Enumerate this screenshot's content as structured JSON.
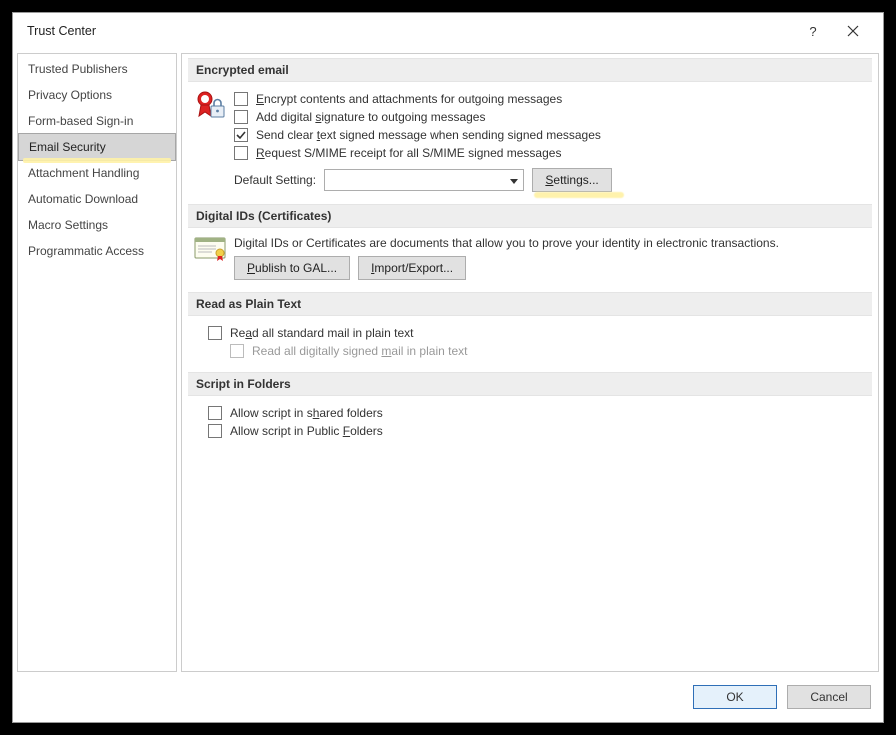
{
  "window": {
    "title": "Trust Center"
  },
  "sidebar": {
    "items": [
      {
        "label": "Trusted Publishers"
      },
      {
        "label": "Privacy Options"
      },
      {
        "label": "Form-based Sign-in"
      },
      {
        "label": "Email Security",
        "selected": true,
        "highlighted": true
      },
      {
        "label": "Attachment Handling"
      },
      {
        "label": "Automatic Download"
      },
      {
        "label": "Macro Settings"
      },
      {
        "label": "Programmatic Access"
      }
    ]
  },
  "sections": {
    "encrypted": {
      "header": "Encrypted email",
      "opts": {
        "encrypt": {
          "pre": "",
          "u": "E",
          "post": "ncrypt contents and attachments for outgoing messages",
          "checked": false
        },
        "sign": {
          "pre": "Add digital ",
          "u": "s",
          "post": "ignature to outgoing messages",
          "checked": false
        },
        "clear": {
          "pre": "Send clear ",
          "u": "t",
          "post": "ext signed message when sending signed messages",
          "checked": true
        },
        "receipt": {
          "pre": "",
          "u": "R",
          "post": "equest S/MIME receipt for all S/MIME signed messages",
          "checked": false
        }
      },
      "default_label": "Default Setting:",
      "default_value": "",
      "settings_button": {
        "pre": "",
        "u": "S",
        "post": "ettings..."
      }
    },
    "digital": {
      "header": "Digital IDs (Certificates)",
      "desc": "Digital IDs or Certificates are documents that allow you to prove your identity in electronic transactions.",
      "publish_button": {
        "pre": "",
        "u": "P",
        "post": "ublish to GAL..."
      },
      "import_button": {
        "pre": "",
        "u": "I",
        "post": "mport/Export..."
      }
    },
    "plaintext": {
      "header": "Read as Plain Text",
      "standard": {
        "pre": "Re",
        "u": "a",
        "post": "d all standard mail in plain text",
        "checked": false
      },
      "signed": {
        "pre": "Read all digitally signed ",
        "u": "m",
        "post": "ail in plain text",
        "checked": false,
        "disabled": true
      }
    },
    "script": {
      "header": "Script in Folders",
      "shared": {
        "pre": "Allow script in s",
        "u": "h",
        "post": "ared folders",
        "checked": false
      },
      "public": {
        "pre": "Allow script in Public ",
        "u": "F",
        "post": "olders",
        "checked": false
      }
    }
  },
  "footer": {
    "ok": "OK",
    "cancel": "Cancel"
  }
}
